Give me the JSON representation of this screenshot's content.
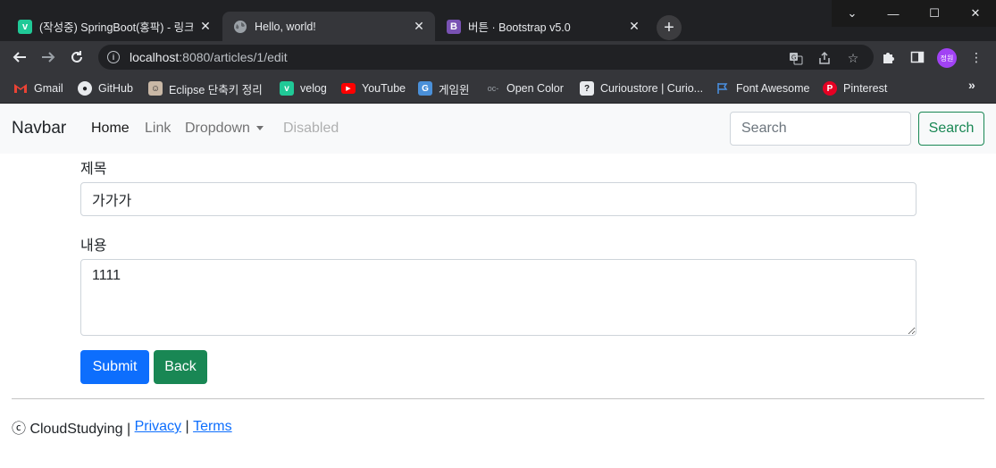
{
  "browser": {
    "tabs": [
      {
        "title": "(작성중) SpringBoot(홍팍) - 링크",
        "favicon": "v",
        "favicon_color": "#20c997",
        "active": false
      },
      {
        "title": "Hello, world!",
        "favicon": "globe",
        "active": true
      },
      {
        "title": "버튼 · Bootstrap v5.0",
        "favicon": "B",
        "favicon_color": "#7952b3",
        "active": false
      }
    ],
    "url_host": "localhost",
    "url_rest": ":8080/articles/1/edit",
    "profile_label": "정원",
    "bookmarks": [
      {
        "label": "Gmail",
        "icon": "gmail-icon"
      },
      {
        "label": "GitHub",
        "icon": "github-icon"
      },
      {
        "label": "Eclipse 단축키 정리",
        "icon": "avatar-icon"
      },
      {
        "label": "velog",
        "icon": "velog-icon"
      },
      {
        "label": "YouTube",
        "icon": "youtube-icon"
      },
      {
        "label": "게임윈",
        "icon": "g-icon"
      },
      {
        "label": "Open Color",
        "icon": "oc-icon"
      },
      {
        "label": "Curioustore | Curio...",
        "icon": "question-icon"
      },
      {
        "label": "Font Awesome",
        "icon": "flag-icon"
      },
      {
        "label": "Pinterest",
        "icon": "pinterest-icon"
      }
    ]
  },
  "navbar": {
    "brand": "Navbar",
    "links": {
      "home": "Home",
      "link": "Link",
      "dropdown": "Dropdown",
      "disabled": "Disabled"
    },
    "search_placeholder": "Search",
    "search_button": "Search"
  },
  "form": {
    "title_label": "제목",
    "title_value": "가가가",
    "content_label": "내용",
    "content_value": "1111",
    "submit_label": "Submit",
    "back_label": "Back"
  },
  "footer": {
    "copyright": "ⓒ CloudStudying | ",
    "privacy": "Privacy",
    "separator": " | ",
    "terms": "Terms"
  },
  "colors": {
    "primary": "#0d6efd",
    "success": "#198754",
    "chrome_dark": "#202124",
    "chrome_toolbar": "#35363a"
  }
}
